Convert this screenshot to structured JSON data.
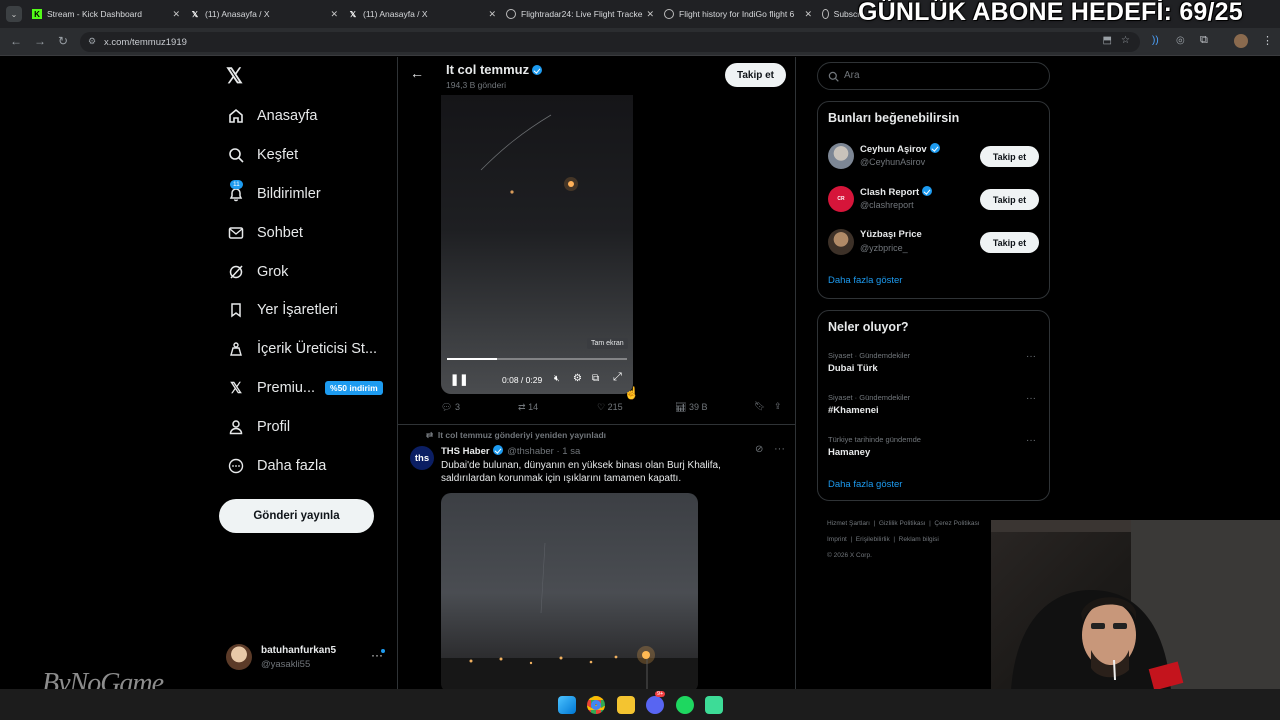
{
  "overlay": {
    "goal_text": "GÜNLÜK ABONE HEDEFİ: 69/25",
    "watermark": "ByNoGame"
  },
  "browser": {
    "tabs": [
      {
        "title": "Stream - Kick Dashboard",
        "icon": "kick-icon"
      },
      {
        "title": "(11) Anasayfa / X",
        "icon": "x-icon"
      },
      {
        "title": "(11) Anasayfa / X",
        "icon": "x-icon"
      },
      {
        "title": "Flightradar24: Live Flight Tracke",
        "icon": "globe-icon"
      },
      {
        "title": "Flight history for IndiGo flight 6",
        "icon": "globe-icon"
      },
      {
        "title": "Subscri",
        "icon": "globe-icon"
      }
    ],
    "url": "x.com/temmuz1919"
  },
  "nav": {
    "items": [
      {
        "label": "Anasayfa",
        "icon": "home-icon"
      },
      {
        "label": "Keşfet",
        "icon": "search-icon"
      },
      {
        "label": "Bildirimler",
        "icon": "bell-icon",
        "badge": "11"
      },
      {
        "label": "Sohbet",
        "icon": "mail-icon"
      },
      {
        "label": "Grok",
        "icon": "grok-icon"
      },
      {
        "label": "Yer İşaretleri",
        "icon": "bookmark-icon"
      },
      {
        "label": "İçerik Üreticisi St...",
        "icon": "creator-icon"
      },
      {
        "label": "Premiu...",
        "icon": "x-premium-icon",
        "badge": "%50 indirim"
      },
      {
        "label": "Profil",
        "icon": "person-icon"
      },
      {
        "label": "Daha fazla",
        "icon": "more-circle-icon"
      }
    ],
    "post_button": "Gönderi yayınla",
    "account": {
      "name": "batuhanfurkan5",
      "handle": "@yasakli55"
    }
  },
  "profile_header": {
    "name": "It col temmuz",
    "posts": "194,3 B gönderi",
    "follow_label": "Takip et"
  },
  "video": {
    "tooltip": "Tam ekran",
    "time": "0:08 / 0:29",
    "progress_fraction": 0.28
  },
  "tweet1_actions": {
    "replies": "3",
    "reposts": "14",
    "likes": "215",
    "views": "39 B"
  },
  "tweet2": {
    "repost_note": "It col temmuz gönderiyi yeniden yayınladı",
    "avatar_text": "ths",
    "name": "THS Haber",
    "meta": "@thshaber · 1 sa",
    "text_line1": "Dubai'de bulunan, dünyanın en yüksek binası olan Burj Khalifa,",
    "text_line2": "saldırılardan korunmak için ışıklarını tamamen kapattı."
  },
  "search": {
    "placeholder": "Ara"
  },
  "suggestions": {
    "title": "Bunları beğenebilirsin",
    "users": [
      {
        "name": "Ceyhun Aşirov",
        "handle": "@CeyhunAsirov",
        "button": "Takip et"
      },
      {
        "name": "Clash Report",
        "handle": "@clashreport",
        "button": "Takip et"
      },
      {
        "name": "Yüzbaşı Price",
        "handle": "@yzbprice_",
        "button": "Takip et"
      }
    ],
    "more": "Daha fazla göster"
  },
  "trends": {
    "title": "Neler oluyor?",
    "items": [
      {
        "category": "Siyaset · Gündemdekiler",
        "name": "Dubai Türk"
      },
      {
        "category": "Siyaset · Gündemdekiler",
        "name": "#Khamenei"
      },
      {
        "category": "Türkiye tarihinde gündemde",
        "name": "Hamaney"
      }
    ],
    "more": "Daha fazla göster"
  },
  "footer": {
    "links": [
      "Hizmet Şartları",
      "Gizlilik Politikası",
      "Çerez Politikası",
      "Imprint",
      "Erişilebilirlik",
      "Reklam bilgisi"
    ],
    "copyright": "© 2026 X Corp."
  },
  "taskbar": {
    "discord_badge": "9+"
  },
  "colors": {
    "accent": "#1d9bf0",
    "background": "#000000",
    "border": "#2f3336",
    "muted": "#71767b"
  }
}
